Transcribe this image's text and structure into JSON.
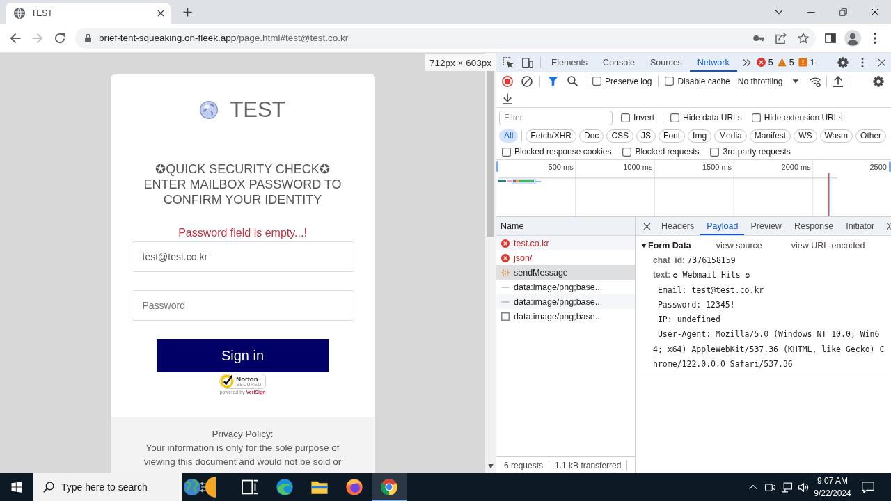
{
  "browser": {
    "tabs": [
      {
        "title": "TEST",
        "selected": true
      }
    ],
    "address": {
      "host": "brief-tent-squeaking.on-fleek.app",
      "path": "/page.html#test@test.co.kr"
    }
  },
  "viewport": {
    "size_label": "712px × 603px"
  },
  "page": {
    "brand": "TEST",
    "heading": "✪QUICK SECURITY CHECK✪",
    "instruction": "ENTER MAILBOX PASSWORD TO CONFIRM YOUR IDENTITY",
    "error": "Password field is empty...!",
    "fields": [
      {
        "kind": "email",
        "value": "test@test.co.kr"
      },
      {
        "kind": "password",
        "placeholder": "Password"
      }
    ],
    "submit": "Sign in",
    "seal": {
      "name": "Norton",
      "tagline": "SECURED",
      "footer": "powered by **VeriSign**"
    },
    "privacy": {
      "title": "Privacy Policy:",
      "text": "Your information is only for the sole purpose of viewing this document and would not be sold or"
    }
  },
  "devtools": {
    "tabs": [
      {
        "label": "Elements",
        "selected": false
      },
      {
        "label": "Console",
        "selected": false
      },
      {
        "label": "Sources",
        "selected": false
      },
      {
        "label": "Network",
        "selected": true
      }
    ],
    "counters": [
      {
        "kind": "error",
        "count": "5"
      },
      {
        "kind": "warning",
        "count": "5"
      },
      {
        "kind": "issue",
        "count": "1"
      }
    ],
    "recording": true,
    "filter_bar": true,
    "options": [
      {
        "label": "Preserve log",
        "checked": false
      },
      {
        "label": "Disable cache",
        "checked": false
      }
    ],
    "throttling": "No throttling",
    "filter": {
      "placeholder": "Filter",
      "options": [
        {
          "label": "Invert",
          "checked": false
        },
        {
          "label": "Hide data URLs",
          "checked": false
        },
        {
          "label": "Hide extension URLs",
          "checked": false
        }
      ]
    },
    "types": [
      {
        "label": "All",
        "selected": true
      },
      {
        "label": "Fetch/XHR",
        "selected": false
      },
      {
        "label": "Doc",
        "selected": false
      },
      {
        "label": "CSS",
        "selected": false
      },
      {
        "label": "JS",
        "selected": false
      },
      {
        "label": "Font",
        "selected": false
      },
      {
        "label": "Img",
        "selected": false
      },
      {
        "label": "Media",
        "selected": false
      },
      {
        "label": "Manifest",
        "selected": false
      },
      {
        "label": "WS",
        "selected": false
      },
      {
        "label": "Wasm",
        "selected": false
      },
      {
        "label": "Other",
        "selected": false
      }
    ],
    "blocked": [
      {
        "label": "Blocked response cookies",
        "checked": false
      },
      {
        "label": "Blocked requests",
        "checked": false
      },
      {
        "label": "3rd-party requests",
        "checked": false
      }
    ],
    "overview": {
      "ticks": [
        "500 ms",
        "1000 ms",
        "1500 ms",
        "2000 ms",
        "2500"
      ]
    },
    "requests": {
      "column": "Name",
      "rows": [
        {
          "name": "test.co.kr",
          "kind": "error",
          "selected": false
        },
        {
          "name": "json/",
          "kind": "error",
          "selected": false
        },
        {
          "name": "sendMessage",
          "kind": "fetch",
          "selected": true
        },
        {
          "name": "data:image/png;base...",
          "kind": "data",
          "selected": false
        },
        {
          "name": "data:image/png;base...",
          "kind": "data",
          "selected": false
        },
        {
          "name": "data:image/png;base...",
          "kind": "image",
          "selected": false
        }
      ],
      "summary": [
        "6 requests",
        "1.1 kB transferred"
      ]
    },
    "details": {
      "tabs": [
        {
          "label": "Headers",
          "selected": false
        },
        {
          "label": "Payload",
          "selected": true
        },
        {
          "label": "Preview",
          "selected": false
        },
        {
          "label": "Response",
          "selected": false
        },
        {
          "label": "Initiator",
          "selected": false
        }
      ],
      "section": {
        "title": "Form Data",
        "expanded": true,
        "actions": [
          "view source",
          "view URL-encoded"
        ]
      },
      "fields": [
        {
          "key": "chat_id:",
          "value": "7376158159"
        },
        {
          "key": "text:",
          "value": "✪ Webmail Hits ✪\n Email: test@test.co.kr\n Password: 12345!\n IP: undefined\n User-Agent: Mozilla/5.0 (Windows NT 10.0; Win64; x64) AppleWebKit/537.36 (KHTML, like Gecko) Chrome/122.0.0.0 Safari/537.36"
        }
      ]
    }
  },
  "taskbar": {
    "search": {
      "placeholder": "Type here to search"
    },
    "apps": [
      {
        "kind": "task-view",
        "active": false
      },
      {
        "kind": "edge",
        "active": false
      },
      {
        "kind": "explorer",
        "active": false
      },
      {
        "kind": "firefox",
        "active": false
      },
      {
        "kind": "chrome",
        "active": true
      }
    ],
    "clock": {
      "time": "9:07 AM",
      "date": "9/22/2024"
    }
  }
}
